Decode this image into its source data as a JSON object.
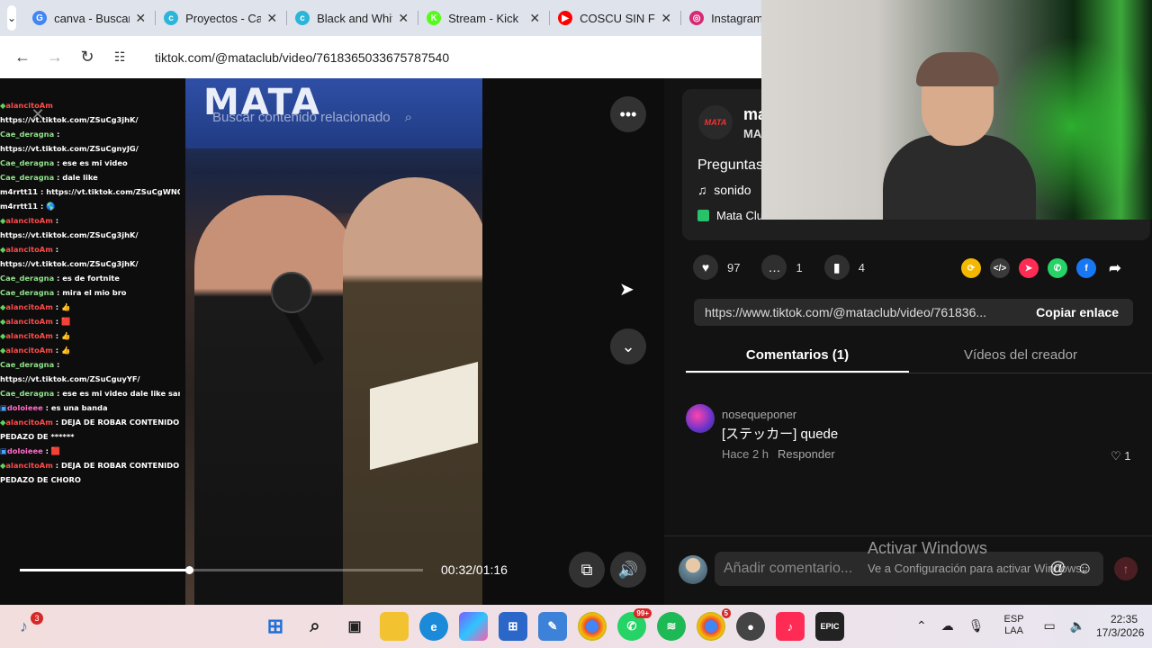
{
  "browser": {
    "tabs": [
      {
        "title": "canva - Buscar",
        "fav": "G",
        "color": "#4285f4"
      },
      {
        "title": "Proyectos - Canva",
        "fav": "c",
        "color": "#2bb5d8"
      },
      {
        "title": "Black and White",
        "fav": "c",
        "color": "#2bb5d8"
      },
      {
        "title": "Stream - Kick",
        "fav": "K",
        "color": "#53fc18"
      },
      {
        "title": "COSCU SIN FILTRO",
        "fav": "▶",
        "color": "#ff0000"
      },
      {
        "title": "Instagram",
        "fav": "◎",
        "color": "#d62976"
      }
    ],
    "url": "tiktok.com/@mataclub/video/7618365033675787540"
  },
  "video": {
    "search_placeholder": "Buscar contenido relacionado",
    "sign_text": "MATA",
    "time": "00:32/01:16",
    "progress": 0.42
  },
  "chat": [
    {
      "user": "alancitoAm",
      "cls": "u1",
      "msg": "",
      "badge": "◆"
    },
    {
      "user": "",
      "cls": "",
      "msg": "https://vt.tiktok.com/ZSuCg3jhK/"
    },
    {
      "user": "Cae_deragna",
      "cls": "u2",
      "msg": " :"
    },
    {
      "user": "",
      "cls": "",
      "msg": "https://vt.tiktok.com/ZSuCgnyJG/"
    },
    {
      "user": "Cae_deragna",
      "cls": "u2",
      "msg": " : ese es mi video"
    },
    {
      "user": "Cae_deragna",
      "cls": "u2",
      "msg": " : dale like"
    },
    {
      "user": "m4rrtt11",
      "cls": "",
      "msg": " : https://vt.tiktok.com/ZSuCgWNQJ/"
    },
    {
      "user": "m4rrtt11",
      "cls": "",
      "msg": " : 🌎"
    },
    {
      "user": "alancitoAm",
      "cls": "u1",
      "msg": " :",
      "badge": "◆"
    },
    {
      "user": "",
      "cls": "",
      "msg": "https://vt.tiktok.com/ZSuCg3jhK/"
    },
    {
      "user": "alancitoAm",
      "cls": "u1",
      "msg": " :",
      "badge": "◆"
    },
    {
      "user": "",
      "cls": "",
      "msg": "https://vt.tiktok.com/ZSuCg3jhK/"
    },
    {
      "user": "Cae_deragna",
      "cls": "u2",
      "msg": " : es de fortnite"
    },
    {
      "user": "Cae_deragna",
      "cls": "u2",
      "msg": " : mira el mio bro"
    },
    {
      "user": "alancitoAm",
      "cls": "u1",
      "msg": " : 👍",
      "badge": "◆"
    },
    {
      "user": "alancitoAm",
      "cls": "u1",
      "msg": " : 🟥",
      "badge": "◆"
    },
    {
      "user": "alancitoAm",
      "cls": "u1",
      "msg": " : 👍",
      "badge": "◆"
    },
    {
      "user": "alancitoAm",
      "cls": "u1",
      "msg": " : 👍",
      "badge": "◆"
    },
    {
      "user": "Cae_deragna",
      "cls": "u2",
      "msg": " :"
    },
    {
      "user": "",
      "cls": "",
      "msg": "https://vt.tiktok.com/ZSuCguyYF/"
    },
    {
      "user": "Cae_deragna",
      "cls": "u2",
      "msg": " : ese es mi video dale like santi"
    },
    {
      "user": "doloieee",
      "cls": "u3",
      "msg": " : es una banda",
      "badge": "▣"
    },
    {
      "user": "alancitoAm",
      "cls": "u1",
      "msg": " : DEJA DE ROBAR CONTENIDO",
      "badge": "◆"
    },
    {
      "user": "",
      "cls": "",
      "msg": "PEDAZO DE ******"
    },
    {
      "user": "doloieee",
      "cls": "u3",
      "msg": " : 🟥",
      "badge": "▣"
    },
    {
      "user": "alancitoAm",
      "cls": "u1",
      "msg": " : DEJA DE ROBAR CONTENIDO",
      "badge": "◆"
    },
    {
      "user": "",
      "cls": "",
      "msg": "PEDAZO DE CHORO"
    }
  ],
  "post": {
    "username": "ma",
    "nickname": "MA",
    "avatar_text": "MATA",
    "description": "Preguntas",
    "music": "sonido",
    "place": "Mata Club",
    "likes": "97",
    "comments": "1",
    "saves": "4",
    "link": "https://www.tiktok.com/@mataclub/video/761836...",
    "copy_label": "Copiar enlace"
  },
  "tabs": {
    "comments": "Comentarios (1)",
    "creator": "Vídeos del creador"
  },
  "comment": {
    "user": "nosequeponer",
    "text": "[ステッカー] quede",
    "time": "Hace 2 h",
    "reply": "Responder",
    "likes": "1"
  },
  "compose": {
    "placeholder": "Añadir comentario...",
    "watermark_title": "Activar Windows",
    "watermark_sub": "Ve a Configuración para activar Windows."
  },
  "taskbar": {
    "notif": "3",
    "whatsapp_badge": "99+",
    "chrome_badge": "5",
    "lang1": "ESP",
    "lang2": "LAA",
    "time": "22:35",
    "date": "17/3/2026"
  }
}
